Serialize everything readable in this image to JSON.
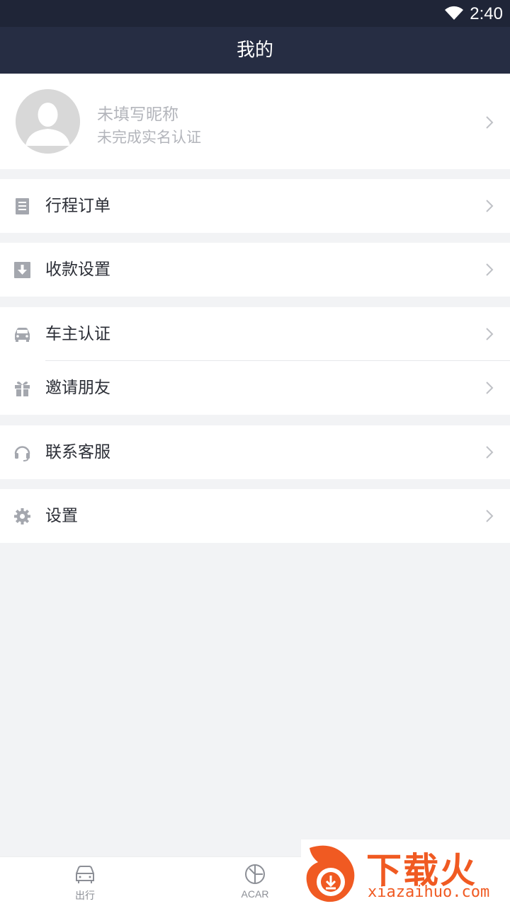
{
  "status_bar": {
    "time": "2:40"
  },
  "header": {
    "title": "我的"
  },
  "profile": {
    "nickname": "未填写昵称",
    "verification": "未完成实名认证"
  },
  "menu": {
    "orders": "行程订单",
    "payment": "收款设置",
    "owner_verify": "车主认证",
    "invite": "邀请朋友",
    "support": "联系客服",
    "settings": "设置"
  },
  "tabs": [
    {
      "label": "出行",
      "icon": "car-icon"
    },
    {
      "label": "ACAR",
      "icon": "acar-icon"
    }
  ],
  "watermark": {
    "brand": "下载火",
    "url": "xiazaihuo.com"
  },
  "colors": {
    "header_bg": "#262d43",
    "page_bg": "#f2f3f5",
    "icon_gray": "#a4a7ae",
    "brand_orange": "#f05a22"
  }
}
